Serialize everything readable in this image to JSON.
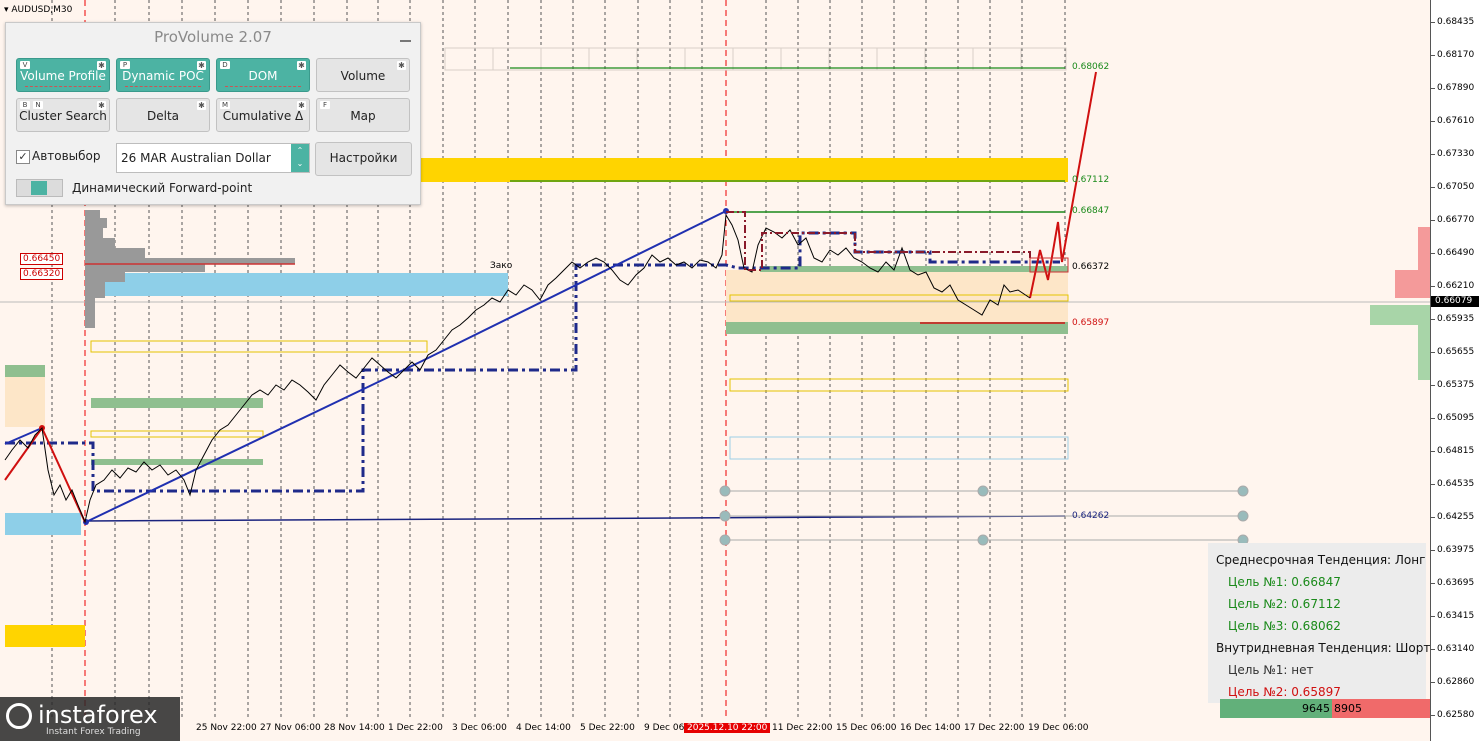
{
  "symbol": "AUDUSD,M30",
  "price_axis": {
    "ticks": [
      "0.68435",
      "0.68170",
      "0.67890",
      "0.67610",
      "0.67330",
      "0.67050",
      "0.66770",
      "0.66490",
      "0.66210",
      "0.65935",
      "0.65655",
      "0.65375",
      "0.65095",
      "0.64815",
      "0.64535",
      "0.64255",
      "0.63975",
      "0.63695",
      "0.63415",
      "0.63140",
      "0.62860",
      "0.62580"
    ],
    "current_price": "0.66079"
  },
  "date_axis": {
    "ticks": [
      "25 Nov 22:00",
      "27 Nov 06:00",
      "28 Nov 14:00",
      "1 Dec 22:00",
      "3 Dec 06:00",
      "4 Dec 14:00",
      "5 Dec 22:00",
      "9 Dec 06:",
      "2025.12.10 22:00",
      "11 Dec 22:00",
      "15 Dec 06:00",
      "16 Dec 14:00",
      "17 Dec 22:00",
      "19 Dec 06:00"
    ],
    "highlighted": "2025.12.10 22:00"
  },
  "levels": {
    "l1": "0.68062",
    "l2": "0.67112",
    "l3": "0.66847",
    "l4": "0.66372",
    "l5": "0.65897",
    "l6": "0.64262"
  },
  "left_boxes": {
    "b1": "0.66450",
    "b2": "0.66320"
  },
  "chart_note": "Зако",
  "provolume": {
    "title": "ProVolume 2.07",
    "buttons": [
      {
        "label": "Volume Profile",
        "key": "V"
      },
      {
        "label": "Dynamic POC",
        "key": "P"
      },
      {
        "label": "DOM",
        "key": "D"
      },
      {
        "label": "Volume",
        "key": ""
      },
      {
        "label": "Cluster Search",
        "key": "B",
        "key2": "N"
      },
      {
        "label": "Delta",
        "key": ""
      },
      {
        "label": "Cumulative Δ",
        "key": "M"
      },
      {
        "label": "Map",
        "key": "F"
      }
    ],
    "auto_select_label": "Автовыбор",
    "auto_select_checked": "✓",
    "instrument": "26 MAR Australian Dollar",
    "settings_label": "Настройки",
    "forward_point_label": "Динамический Forward-point"
  },
  "trend_panel": {
    "mid_term": "Среднесрочная Тенденция: Лонг",
    "mid_t1": "Цель №1: 0.66847",
    "mid_t2": "Цель №2: 0.67112",
    "mid_t3": "Цель №3: 0.68062",
    "intraday": "Внутридневная Тенденция: Шорт",
    "intra_t1": "Цель №1: нет",
    "intra_t2": "Цель №2: 0.65897",
    "colors": {
      "green": "#1a8a1a",
      "red": "#d01010",
      "text": "#111111"
    }
  },
  "volume_bar": {
    "left": "9645",
    "right": "8905"
  },
  "logo": {
    "brand": "instaforex",
    "tagline": "Instant Forex Trading"
  }
}
